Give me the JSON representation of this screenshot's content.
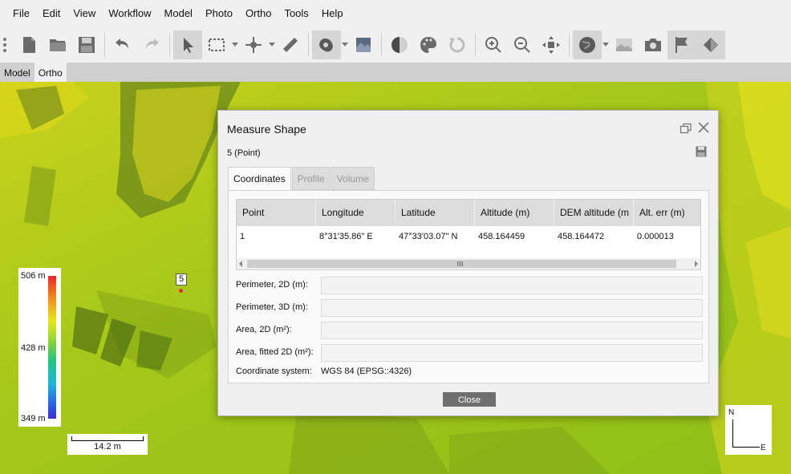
{
  "menu": [
    "File",
    "Edit",
    "View",
    "Workflow",
    "Model",
    "Photo",
    "Ortho",
    "Tools",
    "Help"
  ],
  "view_tabs": [
    {
      "label": "Model",
      "active": false
    },
    {
      "label": "Ortho",
      "active": true
    }
  ],
  "toolbar": {
    "icons": [
      "new-document",
      "open-folder",
      "save-disk",
      "undo",
      "redo",
      "pointer",
      "rectangle-selection",
      "point-marker",
      "ruler",
      "shape-tool",
      "ortho-map",
      "contrast",
      "palette",
      "refresh",
      "zoom-in",
      "zoom-out",
      "fit-view",
      "globe",
      "image-layer",
      "camera",
      "flag",
      "flag-shape"
    ]
  },
  "map": {
    "marker_label": "5",
    "legend": {
      "max": "506 m",
      "mid": "428 m",
      "min": "349 m"
    },
    "scale_bar": "14.2 m",
    "compass": {
      "north": "N",
      "east": "E"
    }
  },
  "dialog": {
    "title": "Measure Shape",
    "subtitle": "5 (Point)",
    "tabs": [
      {
        "label": "Coordinates",
        "active": true
      },
      {
        "label": "Profile",
        "active": false
      },
      {
        "label": "Volume",
        "active": false
      }
    ],
    "table": {
      "columns": [
        "Point",
        "Longitude",
        "Latitude",
        "Altitude (m)",
        "DEM altitude (m",
        "Alt. err (m)"
      ],
      "rows": [
        [
          "1",
          "8°31'35.86\" E",
          "47°33'03.07\" N",
          "458.164459",
          "458.164472",
          "0.000013"
        ]
      ]
    },
    "fields": [
      {
        "label": "Perimeter, 2D (m):",
        "value": ""
      },
      {
        "label": "Perimeter, 3D (m):",
        "value": ""
      },
      {
        "label": "Area, 2D (m²):",
        "value": ""
      },
      {
        "label": "Area, fitted 2D (m²):",
        "value": ""
      }
    ],
    "coordinate_system_label": "Coordinate system:",
    "coordinate_system_value": "WGS 84 (EPSG::4326)",
    "close_label": "Close"
  }
}
